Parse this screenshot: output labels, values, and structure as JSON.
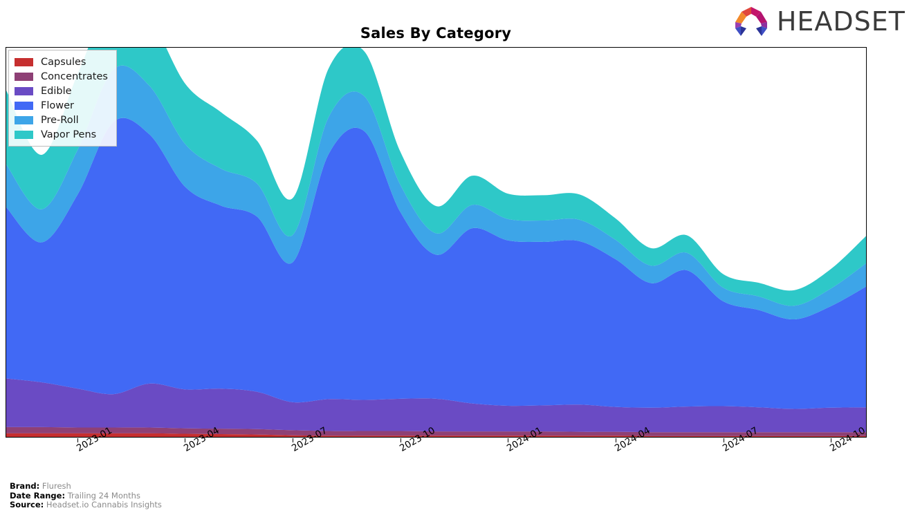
{
  "header": {
    "title": "Sales By Category",
    "logo_text": "HEADSET",
    "logo_icon": "headset-arch-logo"
  },
  "legend": {
    "position": "upper-left",
    "items": [
      {
        "label": "Capsules",
        "color": "#C62F2F"
      },
      {
        "label": "Concentrates",
        "color": "#8E4075"
      },
      {
        "label": "Edible",
        "color": "#6A4BC4"
      },
      {
        "label": "Flower",
        "color": "#4169F5"
      },
      {
        "label": "Pre-Roll",
        "color": "#3DA5E8"
      },
      {
        "label": "Vapor Pens",
        "color": "#2EC8C8"
      }
    ]
  },
  "footer": {
    "rows": [
      {
        "label": "Brand:",
        "value": "Fluresh"
      },
      {
        "label": "Date Range:",
        "value": "Trailing 24 Months"
      },
      {
        "label": "Source:",
        "value": "Headset.io Cannabis Insights"
      }
    ]
  },
  "chart_data": {
    "type": "area",
    "stacked": true,
    "smoothing": "spline",
    "title": "Sales By Category",
    "xlabel": "",
    "ylabel": "",
    "grid": false,
    "legend_position": "upper-left",
    "x": [
      "2022-11",
      "2022-12",
      "2023-01",
      "2023-02",
      "2023-03",
      "2023-04",
      "2023-05",
      "2023-06",
      "2023-07",
      "2023-08",
      "2023-09",
      "2023-10",
      "2023-11",
      "2023-12",
      "2024-01",
      "2024-02",
      "2024-03",
      "2024-04",
      "2024-05",
      "2024-06",
      "2024-07",
      "2024-08",
      "2024-09",
      "2024-10",
      "2024-11"
    ],
    "xtick_labels": [
      "2023-01",
      "2023-04",
      "2023-07",
      "2023-10",
      "2024-01",
      "2024-04",
      "2024-07",
      "2024-10"
    ],
    "ylim": [
      0,
      100
    ],
    "series": [
      {
        "name": "Capsules",
        "color": "#C62F2F",
        "values": [
          0.9,
          0.9,
          0.9,
          0.9,
          0.9,
          0.8,
          0.7,
          0.6,
          0.4,
          0.3,
          0.3,
          0.3,
          0.3,
          0.3,
          0.3,
          0.3,
          0.3,
          0.3,
          0.2,
          0.2,
          0.2,
          0.2,
          0.2,
          0.2,
          0.2
        ]
      },
      {
        "name": "Concentrates",
        "color": "#8E4075",
        "values": [
          1.6,
          1.6,
          1.5,
          1.5,
          1.5,
          1.4,
          1.4,
          1.4,
          1.3,
          1.2,
          1.2,
          1.2,
          1.1,
          1.1,
          1.1,
          1.1,
          1.0,
          1.0,
          1.0,
          1.0,
          1.0,
          1.0,
          1.0,
          1.0,
          1.0
        ]
      },
      {
        "name": "Edible",
        "color": "#6A4BC4",
        "values": [
          12.5,
          11.5,
          10.0,
          8.6,
          11.3,
          10.0,
          10.3,
          9.6,
          7.2,
          8.2,
          8.0,
          8.3,
          8.4,
          7.2,
          6.6,
          6.7,
          7.0,
          6.4,
          6.3,
          6.6,
          6.7,
          6.4,
          6.0,
          6.3,
          6.4
        ]
      },
      {
        "name": "Flower",
        "color": "#4169F5",
        "values": [
          44.0,
          36.0,
          50.0,
          70.0,
          64.0,
          52.0,
          47.0,
          45.0,
          36.0,
          63.0,
          69.0,
          48.0,
          37.0,
          45.0,
          42.5,
          42.0,
          42.0,
          38.0,
          32.0,
          35.0,
          27.0,
          25.0,
          23.0,
          26.0,
          31.0
        ]
      },
      {
        "name": "Pre-Roll",
        "color": "#3DA5E8",
        "values": [
          11.0,
          8.5,
          11.5,
          13.5,
          12.5,
          11.0,
          9.5,
          8.5,
          7.0,
          9.5,
          9.0,
          7.0,
          5.5,
          6.0,
          5.5,
          5.5,
          5.5,
          5.0,
          4.5,
          4.5,
          3.5,
          3.5,
          3.5,
          4.5,
          6.0
        ]
      },
      {
        "name": "Vapor Pens",
        "color": "#2EC8C8",
        "values": [
          19.0,
          14.0,
          19.5,
          19.0,
          17.5,
          15.5,
          14.5,
          11.0,
          9.5,
          12.5,
          11.5,
          8.5,
          7.0,
          7.5,
          6.5,
          6.5,
          6.5,
          5.5,
          4.5,
          4.5,
          3.5,
          3.5,
          4.0,
          5.0,
          7.0
        ]
      }
    ]
  }
}
